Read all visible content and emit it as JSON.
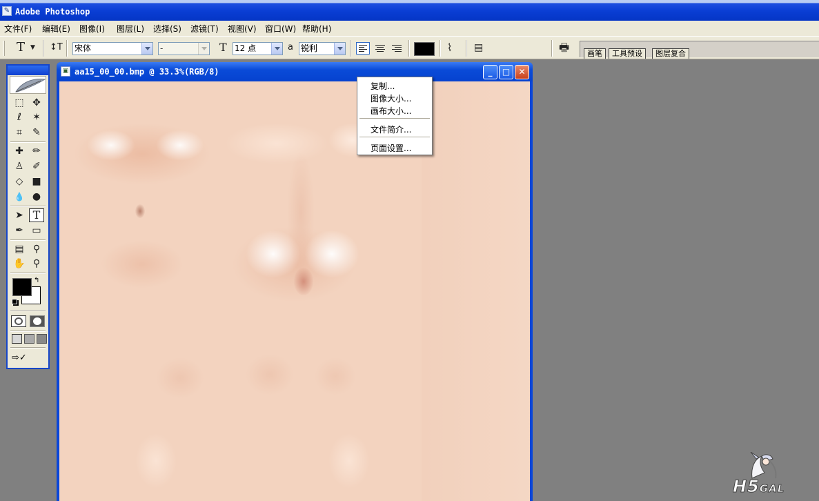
{
  "app": {
    "title": "Adobe Photoshop",
    "icon": "photoshop-feather-icon"
  },
  "menubar": {
    "items": [
      {
        "label": "文件(F)"
      },
      {
        "label": "编辑(E)"
      },
      {
        "label": "图像(I)"
      },
      {
        "label": "图层(L)"
      },
      {
        "label": "选择(S)"
      },
      {
        "label": "滤镜(T)"
      },
      {
        "label": "视图(V)"
      },
      {
        "label": "窗口(W)"
      },
      {
        "label": "帮助(H)"
      }
    ]
  },
  "options": {
    "tool_glyph": "T",
    "orientation_glyph": "↕T",
    "font_family": "宋体",
    "font_style": "-",
    "size_glyph": "T",
    "font_size": "12 点",
    "aa_glyph": "a",
    "anti_alias": "锐利",
    "text_color": "#000000",
    "palette_tabs": [
      "画笔",
      "工具预设",
      "图层复合"
    ]
  },
  "toolbox": {
    "tools": [
      {
        "glyph": "⬚",
        "name": "marquee-tool-icon"
      },
      {
        "glyph": "✥",
        "name": "move-tool-icon"
      },
      {
        "glyph": "ℓ",
        "name": "lasso-tool-icon"
      },
      {
        "glyph": "✶",
        "name": "magic-wand-icon"
      },
      {
        "glyph": "⌗",
        "name": "crop-tool-icon"
      },
      {
        "glyph": "✎",
        "name": "slice-tool-icon"
      },
      {
        "glyph": "✚",
        "name": "healing-brush-icon"
      },
      {
        "glyph": "✏",
        "name": "brush-tool-icon"
      },
      {
        "glyph": "♙",
        "name": "clone-stamp-icon"
      },
      {
        "glyph": "✐",
        "name": "history-brush-icon"
      },
      {
        "glyph": "◇",
        "name": "eraser-tool-icon"
      },
      {
        "glyph": "■",
        "name": "gradient-tool-icon"
      },
      {
        "glyph": "💧",
        "name": "blur-tool-icon"
      },
      {
        "glyph": "●",
        "name": "dodge-tool-icon"
      },
      {
        "glyph": "➤",
        "name": "path-select-icon"
      },
      {
        "glyph": "T",
        "name": "type-tool-icon"
      },
      {
        "glyph": "✒",
        "name": "pen-tool-icon"
      },
      {
        "glyph": "▭",
        "name": "shape-tool-icon"
      },
      {
        "glyph": "▤",
        "name": "notes-tool-icon"
      },
      {
        "glyph": "⚲",
        "name": "eyedropper-icon"
      },
      {
        "glyph": "✋",
        "name": "hand-tool-icon"
      },
      {
        "glyph": "⚲",
        "name": "zoom-tool-icon"
      }
    ],
    "foreground_color": "#000000",
    "background_color": "#ffffff"
  },
  "document": {
    "title": "aa15_00_00.bmp @ 33.3%(RGB/8)",
    "buttons": {
      "minimize": "_",
      "maximize": "□",
      "close": "✕"
    }
  },
  "context_menu": {
    "items": [
      {
        "label": "复制..."
      },
      {
        "label": "图像大小..."
      },
      {
        "label": "画布大小..."
      },
      {
        "label": "文件简介..."
      },
      {
        "label": "页面设置..."
      }
    ]
  },
  "watermark": {
    "text_main": "H5",
    "text_small": "GAL"
  }
}
